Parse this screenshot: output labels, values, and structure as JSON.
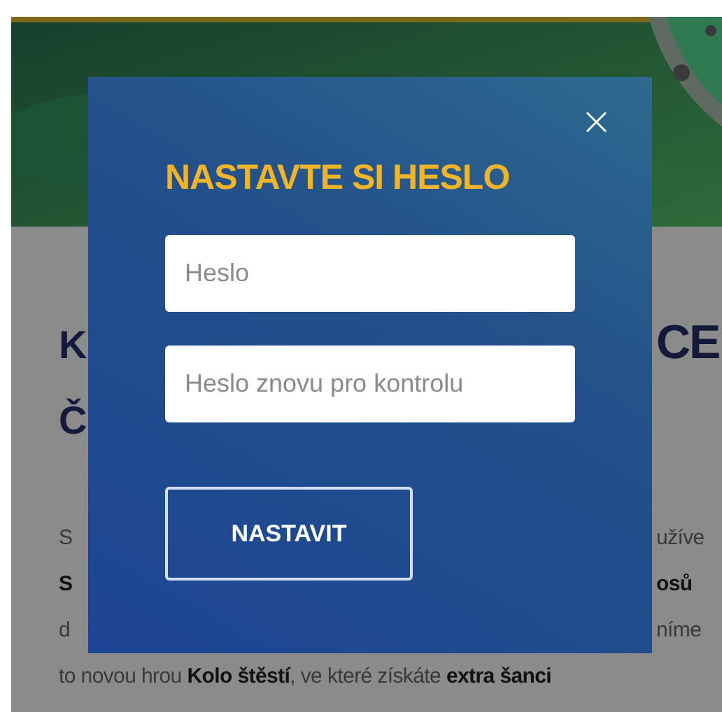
{
  "page": {
    "heading_lines": [
      {
        "left": "K",
        "right": "CE"
      },
      {
        "left": "Č"
      }
    ],
    "paragraph_lines": [
      {
        "left": "S",
        "right": "užíve"
      },
      {
        "left": "**S**",
        "right": "**osů**"
      },
      {
        "left": "d",
        "right": "níme"
      },
      {
        "full": "to novou hrou **Kolo štěstí**, ve které získáte **extra šanci**"
      }
    ]
  },
  "modal": {
    "title": "NASTAVTE SI HESLO",
    "close": "×",
    "fields": [
      {
        "placeholder": "Heslo"
      },
      {
        "placeholder": "Heslo znovu pro kontrolu"
      }
    ],
    "button": "NASTAVIT"
  }
}
